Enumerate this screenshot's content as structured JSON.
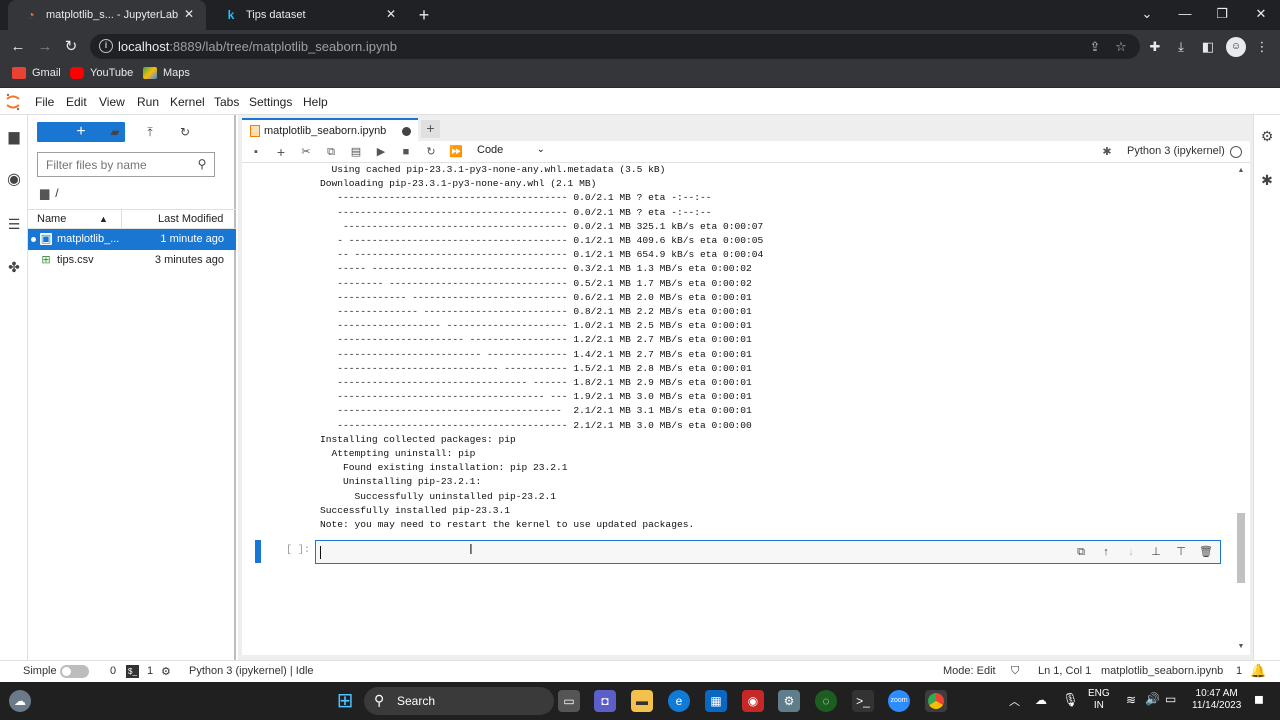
{
  "browser": {
    "tabs": [
      {
        "title": "matplotlib_s... - JupyterLab",
        "active": true
      },
      {
        "title": "Tips dataset",
        "active": false
      }
    ],
    "url_host": "localhost",
    "url_rest": ":8889/lab/tree/matplotlib_seaborn.ipynb",
    "bookmarks": [
      "Gmail",
      "YouTube",
      "Maps"
    ]
  },
  "menu": [
    "File",
    "Edit",
    "View",
    "Run",
    "Kernel",
    "Tabs",
    "Settings",
    "Help"
  ],
  "filebrowser": {
    "new_label": "+",
    "filter_placeholder": "Filter files by name",
    "path": "/",
    "col_name": "Name",
    "col_modified": "Last Modified",
    "files": [
      {
        "name": "matplotlib_...",
        "modified": "1 minute ago",
        "selected": true
      },
      {
        "name": "tips.csv",
        "modified": "3 minutes ago",
        "selected": false
      }
    ]
  },
  "notebook": {
    "tab_title": "matplotlib_seaborn.ipynb",
    "cell_type": "Code",
    "kernel": "Python 3 (ipykernel)",
    "prompt": "[ ]:",
    "output_lines": [
      "  Using cached pip-23.3.1-py3-none-any.whl.metadata (3.5 kB)",
      "Downloading pip-23.3.1-py3-none-any.whl (2.1 MB)",
      "   ---------------------------------------- 0.0/2.1 MB ? eta -:--:--",
      "   ---------------------------------------- 0.0/2.1 MB ? eta -:--:--",
      "    --------------------------------------- 0.0/2.1 MB 325.1 kB/s eta 0:00:07",
      "   - -------------------------------------- 0.1/2.1 MB 409.6 kB/s eta 0:00:05",
      "   -- ------------------------------------- 0.1/2.1 MB 654.9 kB/s eta 0:00:04",
      "   ----- ---------------------------------- 0.3/2.1 MB 1.3 MB/s eta 0:00:02",
      "   -------- ------------------------------- 0.5/2.1 MB 1.7 MB/s eta 0:00:02",
      "   ------------ --------------------------- 0.6/2.1 MB 2.0 MB/s eta 0:00:01",
      "   -------------- ------------------------- 0.8/2.1 MB 2.2 MB/s eta 0:00:01",
      "   ------------------ --------------------- 1.0/2.1 MB 2.5 MB/s eta 0:00:01",
      "   ---------------------- ----------------- 1.2/2.1 MB 2.7 MB/s eta 0:00:01",
      "   ------------------------- -------------- 1.4/2.1 MB 2.7 MB/s eta 0:00:01",
      "   ---------------------------- ----------- 1.5/2.1 MB 2.8 MB/s eta 0:00:01",
      "   --------------------------------- ------ 1.8/2.1 MB 2.9 MB/s eta 0:00:01",
      "   ------------------------------------ --- 1.9/2.1 MB 3.0 MB/s eta 0:00:01",
      "   ---------------------------------------  2.1/2.1 MB 3.1 MB/s eta 0:00:01",
      "   ---------------------------------------- 2.1/2.1 MB 3.0 MB/s eta 0:00:00",
      "Installing collected packages: pip",
      "  Attempting uninstall: pip",
      "    Found existing installation: pip 23.2.1",
      "    Uninstalling pip-23.2.1:",
      "      Successfully uninstalled pip-23.2.1",
      "Successfully installed pip-23.3.1",
      "Note: you may need to restart the kernel to use updated packages."
    ]
  },
  "statusbar": {
    "mode_label": "Simple",
    "terminals": "0",
    "kernels": "1",
    "kernel_status": "Python 3 (ipykernel) | Idle",
    "edit_mode": "Mode: Edit",
    "cursor": "Ln 1, Col 1",
    "file": "matplotlib_seaborn.ipynb",
    "notifications": "1"
  },
  "taskbar": {
    "search_label": "Search",
    "lang_top": "ENG",
    "lang_bottom": "IN",
    "time": "10:47 AM",
    "date": "11/14/2023"
  },
  "colors": {
    "accent": "#1976d2",
    "browser_dark": "#202124",
    "browser_toolbar": "#35363a"
  }
}
